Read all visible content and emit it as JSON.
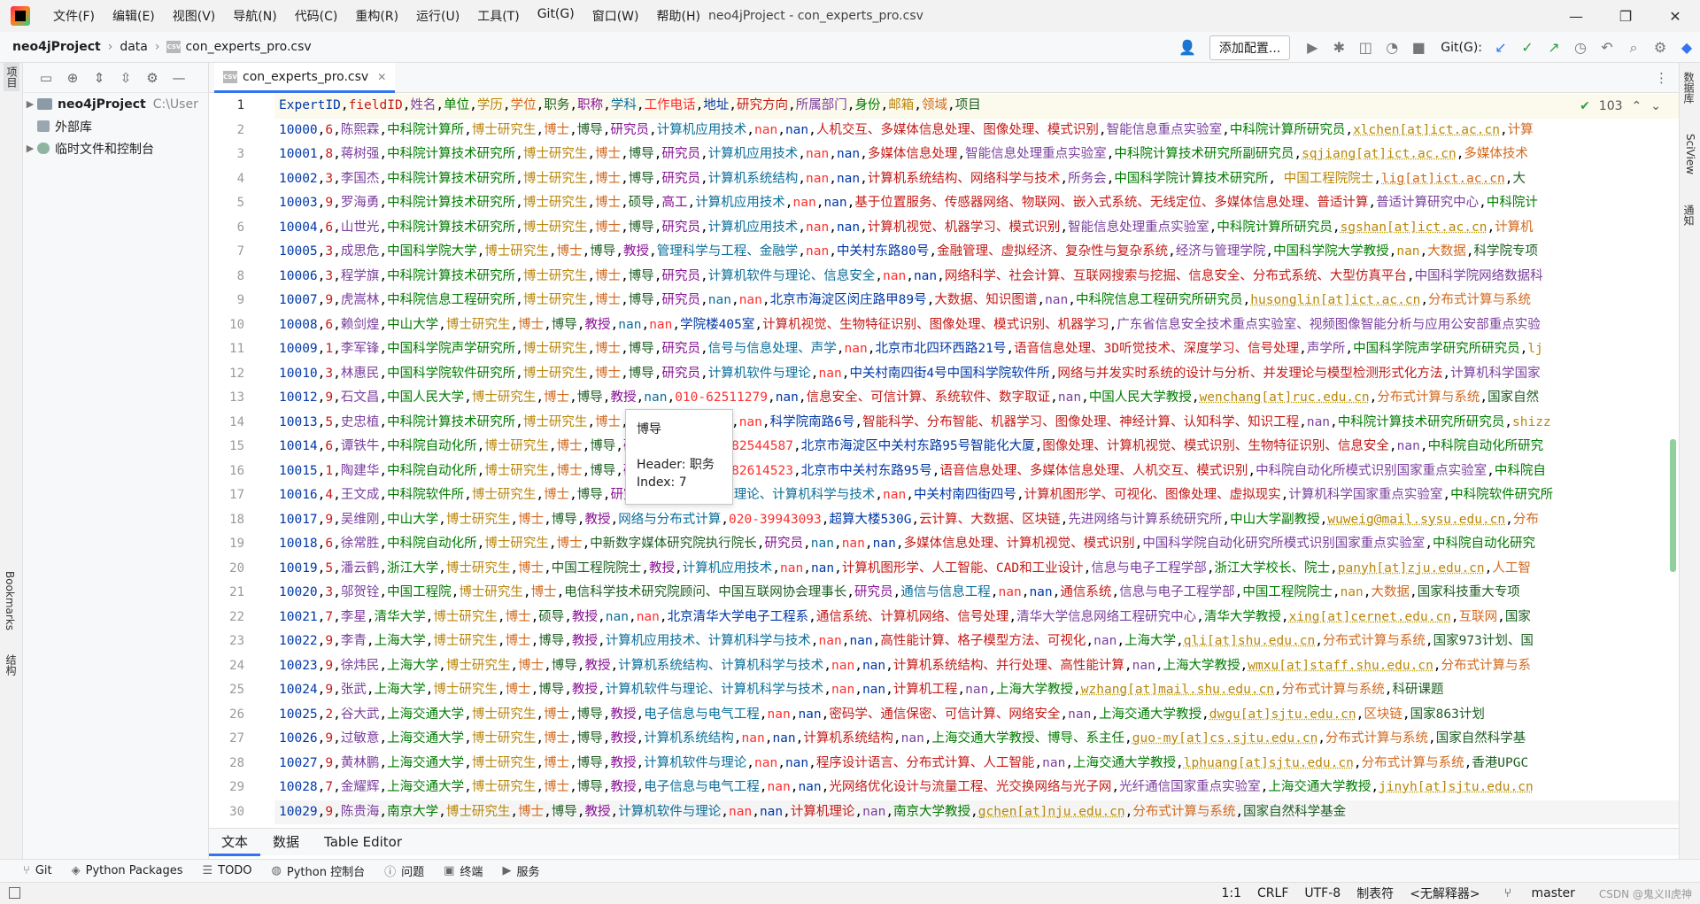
{
  "titlebar": {
    "menu": [
      "文件(F)",
      "编辑(E)",
      "视图(V)",
      "导航(N)",
      "代码(C)",
      "重构(R)",
      "运行(U)",
      "工具(T)",
      "Git(G)",
      "窗口(W)",
      "帮助(H)"
    ],
    "title": "neo4jProject - con_experts_pro.csv",
    "min": "—",
    "max": "❐",
    "close": "✕"
  },
  "navbar": {
    "project": "neo4jProject",
    "folder": "data",
    "file": "con_experts_pro.csv",
    "add_config": "添加配置...",
    "git_label": "Git(G):"
  },
  "left_strip": {
    "project": "项目",
    "bookmarks": "Bookmarks",
    "structure": "结构"
  },
  "right_strip": {
    "database": "数据库",
    "sciview": "SciView",
    "notifications": "通知"
  },
  "project_panel": {
    "root": "neo4jProject",
    "root_path": "C:\\User",
    "external": "外部库",
    "scratches": "临时文件和控制台"
  },
  "editor": {
    "tab": "con_experts_pro.csv",
    "inspection_count": "103",
    "line_numbers": [
      "1",
      "2",
      "3",
      "4",
      "5",
      "6",
      "7",
      "8",
      "9",
      "10",
      "11",
      "12",
      "13",
      "14",
      "15",
      "16",
      "17",
      "18",
      "19",
      "20",
      "21",
      "22",
      "23",
      "24",
      "25",
      "26",
      "27",
      "28",
      "29",
      "30"
    ],
    "lines": [
      "ExpertID,fieldID,姓名,单位,学历,学位,职务,职称,学科,工作电话,地址,研究方向,所属部门,身份,邮箱,领域,项目",
      "10000,6,陈熙霖,中科院计算所,博士研究生,博士,博导,研究员,计算机应用技术,nan,nan,人机交互、多媒体信息处理、图像处理、模式识别,智能信息重点实验室,中科院计算所研究员,xlchen[at]ict.ac.cn,计算",
      "10001,8,蒋树强,中科院计算技术研究所,博士研究生,博士,博导,研究员,计算机应用技术,nan,nan,多媒体信息处理,智能信息处理重点实验室,中科院计算技术研究所副研究员,sqjiang[at]ict.ac.cn,多媒体技术",
      "10002,3,李国杰,中科院计算技术研究所,博士研究生,博士,博导,研究员,计算机系统结构,nan,nan,计算机系统结构、网络科学与技术,所务会,中国科学院计算技术研究所, 中国工程院院士,lig[at]ict.ac.cn,大",
      "10003,9,罗海勇,中科院计算技术研究所,博士研究生,博士,硕导,高工,计算机应用技术,nan,nan,基于位置服务、传感器网络、物联网、嵌入式系统、无线定位、多媒体信息处理、普适计算,普适计算研究中心,中科院计",
      "10004,6,山世光,中科院计算技术研究所,博士研究生,博士,博导,研究员,计算机应用技术,nan,nan,计算机视觉、机器学习、模式识别,智能信息处理重点实验室,中科院计算所研究员,sgshan[at]ict.ac.cn,计算机",
      "10005,3,成思危,中国科学院大学,博士研究生,博士,博导,教授,管理科学与工程、金融学,nan,中关村东路80号,金融管理、虚拟经济、复杂性与复杂系统,经济与管理学院,中国科学院大学教授,nan,大数据,科学院专项",
      "10006,3,程学旗,中科院计算技术研究所,博士研究生,博士,博导,研究员,计算机软件与理论、信息安全,nan,nan,网络科学、社会计算、互联网搜索与挖掘、信息安全、分布式系统、大型仿真平台,中国科学院网络数据科",
      "10007,9,虎嵩林,中科院信息工程研究所,博士研究生,博士,博导,研究员,nan,nan,北京市海淀区闵庄路甲89号,大数据、知识图谱,nan,中科院信息工程研究所研究员,husonglin[at]ict.ac.cn,分布式计算与系统",
      "10008,6,赖剑煌,中山大学,博士研究生,博士,博导,教授,nan,nan,学院楼405室,计算机视觉、生物特征识别、图像处理、模式识别、机器学习,广东省信息安全技术重点实验室、视频图像智能分析与应用公安部重点实验",
      "10009,1,李军锋,中国科学院声学研究所,博士研究生,博士,博导,研究员,信号与信息处理、声学,nan,北京市北四环西路21号,语音信息处理、3D听觉技术、深度学习、信号处理,声学所,中国科学院声学研究所研究员,lj",
      "10010,3,林惠民,中国科学院软件研究所,博士研究生,博士,博导,研究员,计算机软件与理论,nan,中关村南四街4号中国科学院软件所,网络与并发实时系统的设计与分析、并发理论与模型检测形式化方法,计算机科学国家",
      "10012,9,石文昌,中国人民大学,博士研究生,博士,博导,教授,nan,010-62511279,nan,信息安全、可信计算、系统软件、数字取证,nan,中国人民大学教授,wenchang[at]ruc.edu.cn,分布式计算与系统,国家自然",
      "10013,5,史忠植,中科院计算技术研究所,博士研究生,博士,博导,研究员,nan,nan,科学院南路6号,智能科学、分布智能、机器学习、图像处理、神经计算、认知科学、知识工程,nan,中科院计算技术研究所研究员,shizz",
      "10014,6,谭铁牛,中科院自动化所,博士研究生,博士,博导,研究员,nan,010-82544587,北京市海淀区中关村东路95号智能化大厦,图像处理、计算机视觉、模式识别、生物特征识别、信息安全,nan,中科院自动化所研究",
      "10015,1,陶建华,中科院自动化所,博士研究生,博士,博导,研究员,nan,010-82614523,北京市中关村东路95号,语音信息处理、多媒体信息处理、人机交互、模式识别,中科院自动化所模式识别国家重点实验室,中科院自",
      "10016,4,王文成,中科院软件所,博士研究生,博士,博导,研究员,计算机软件与理论、计算机科学与技术,nan,中关村南四街四号,计算机图形学、可视化、图像处理、虚拟现实,计算机科学国家重点实验室,中科院软件研究所",
      "10017,9,吴维刚,中山大学,博士研究生,博士,博导,教授,网络与分布式计算,020-39943093,超算大楼530G,云计算、大数据、区块链,先进网络与计算系统研究所,中山大学副教授,wuweig@mail.sysu.edu.cn,分布",
      "10018,6,徐常胜,中科院自动化所,博士研究生,博士,中新数字媒体研究院执行院长,研究员,nan,nan,nan,多媒体信息处理、计算机视觉、模式识别,中国科学院自动化研究所模式识别国家重点实验室,中科院自动化研究",
      "10019,5,潘云鹤,浙江大学,博士研究生,博士,中国工程院院士,教授,计算机应用技术,nan,nan,计算机图形学、人工智能、CAD和工业设计,信息与电子工程学部,浙江大学校长、院士,panyh[at]zju.edu.cn,人工智",
      "10020,3,邬贺铨,中国工程院,博士研究生,博士,电信科学技术研究院顾问、中国互联网协会理事长,研究员,通信与信息工程,nan,nan,通信系统,信息与电子工程学部,中国工程院院士,nan,大数据,国家科技重大专项",
      "10021,7,李星,清华大学,博士研究生,博士,硕导,教授,nan,nan,北京清华大学电子工程系,通信系统、计算机网络、信号处理,清华大学信息网络工程研究中心,清华大学教授,xing[at]cernet.edu.cn,互联网,国家",
      "10022,9,李青,上海大学,博士研究生,博士,博导,教授,计算机应用技术、计算机科学与技术,nan,nan,高性能计算、格子模型方法、可视化,nan,上海大学,qli[at]shu.edu.cn,分布式计算与系统,国家973计划、国",
      "10023,9,徐炜民,上海大学,博士研究生,博士,博导,教授,计算机系统结构、计算机科学与技术,nan,nan,计算机系统结构、并行处理、高性能计算,nan,上海大学教授,wmxu[at]staff.shu.edu.cn,分布式计算与系",
      "10024,9,张武,上海大学,博士研究生,博士,博导,教授,计算机软件与理论、计算机科学与技术,nan,nan,计算机工程,nan,上海大学教授,wzhang[at]mail.shu.edu.cn,分布式计算与系统,科研课题",
      "10025,2,谷大武,上海交通大学,博士研究生,博士,博导,教授,电子信息与电气工程,nan,nan,密码学、通信保密、可信计算、网络安全,nan,上海交通大学教授,dwgu[at]sjtu.edu.cn,区块链,国家863计划",
      "10026,9,过敏意,上海交通大学,博士研究生,博士,博导,教授,计算机系统结构,nan,nan,计算机系统结构,nan,上海交通大学教授、博导、系主任,guo-my[at]cs.sjtu.edu.cn,分布式计算与系统,国家自然科学基",
      "10027,9,黄林鹏,上海交通大学,博士研究生,博士,博导,教授,计算机软件与理论,nan,nan,程序设计语言、分布式计算、人工智能,nan,上海交通大学教授,lphuang[at]sjtu.edu.cn,分布式计算与系统,香港UPGC",
      "10028,7,金耀辉,上海交通大学,博士研究生,博士,博导,教授,电子信息与电气工程,nan,nan,光网络优化设计与流量工程、光交换网络与光子网,光纤通信国家重点实验室,上海交通大学教授,jinyh[at]sjtu.edu.cn",
      "10029,9,陈贵海,南京大学,博士研究生,博士,博导,教授,计算机软件与理论,nan,nan,计算机理论,nan,南京大学教授,gchen[at]nju.edu.cn,分布式计算与系统,国家自然科学基金"
    ]
  },
  "tooltip": {
    "value": "博导",
    "header": "Header: 职务",
    "index": "Index: 7"
  },
  "editor_tabs": [
    "文本",
    "数据",
    "Table Editor"
  ],
  "tool_windows": [
    {
      "icon": "git-icon",
      "label": "Git"
    },
    {
      "icon": "python-packages-icon",
      "label": "Python Packages"
    },
    {
      "icon": "todo-icon",
      "label": "TODO"
    },
    {
      "icon": "python-console-icon",
      "label": "Python 控制台"
    },
    {
      "icon": "problems-icon",
      "label": "问题"
    },
    {
      "icon": "terminal-icon",
      "label": "终端"
    },
    {
      "icon": "services-icon",
      "label": "服务"
    }
  ],
  "status": {
    "position": "1:1",
    "line_sep": "CRLF",
    "encoding": "UTF-8",
    "indent": "制表符",
    "interpreter": "<无解释器>",
    "branch": "master",
    "watermark": "CSDN @鬼义II虎神"
  }
}
